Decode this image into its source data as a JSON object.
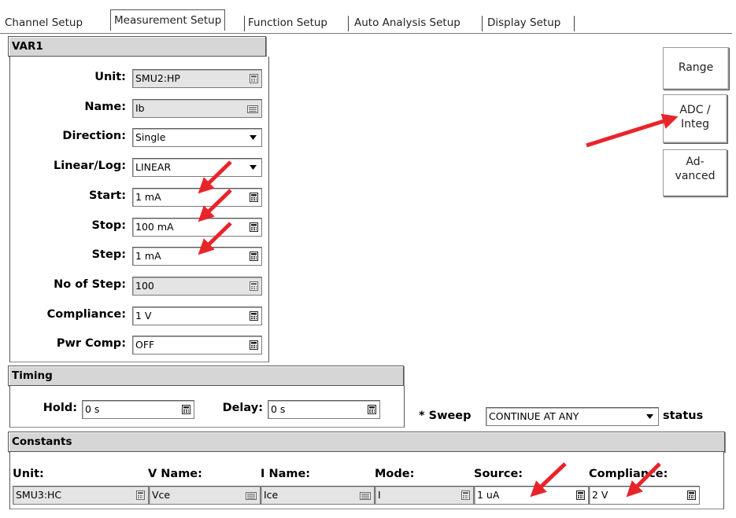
{
  "tabs": [
    "Channel Setup",
    "Measurement Setup",
    "Function Setup",
    "Auto Analysis Setup",
    "Display Setup"
  ],
  "var1": {
    "title": "VAR1",
    "fields": [
      {
        "label": "Unit:",
        "value": "SMU2:HP",
        "kind": "calc",
        "gray": true
      },
      {
        "label": "Name:",
        "value": "Ib",
        "kind": "kbd",
        "gray": true
      },
      {
        "label": "Direction:",
        "value": "Single",
        "kind": "dropdown",
        "gray": false
      },
      {
        "label": "Linear/Log:",
        "value": "LINEAR",
        "kind": "dropdown",
        "gray": false
      },
      {
        "label": "Start:",
        "value": "1 mA",
        "kind": "calc",
        "gray": false
      },
      {
        "label": "Stop:",
        "value": "100 mA",
        "kind": "calc",
        "gray": false
      },
      {
        "label": "Step:",
        "value": "1 mA",
        "kind": "calc",
        "gray": false
      },
      {
        "label": "No of Step:",
        "value": "100",
        "kind": "calc",
        "gray": true
      },
      {
        "label": "Compliance:",
        "value": "1 V",
        "kind": "calc",
        "gray": false
      },
      {
        "label": "Pwr Comp:",
        "value": "OFF",
        "kind": "calc",
        "gray": false
      }
    ]
  },
  "side_buttons": [
    "Range",
    "ADC /\nInteg",
    "Ad-\nvanced"
  ],
  "timing": {
    "title": "Timing",
    "hold_label": "Hold:",
    "hold_value": "0 s",
    "delay_label": "Delay:",
    "delay_value": "0 s",
    "sweep_label": "* Sweep",
    "sweep_value": "CONTINUE AT ANY",
    "status_label": "status"
  },
  "constants": {
    "title": "Constants",
    "headers": [
      "Unit:",
      "V Name:",
      "I Name:",
      "Mode:",
      "Source:",
      "Compliance:"
    ],
    "values": [
      "SMU3:HC",
      "Vce",
      "Ice",
      "I",
      "1 uA",
      "2 V"
    ]
  },
  "colors": {
    "arrow": "#e8242b",
    "header_bg": "#d6d6d6",
    "readonly_bg": "#e4e4e4"
  }
}
